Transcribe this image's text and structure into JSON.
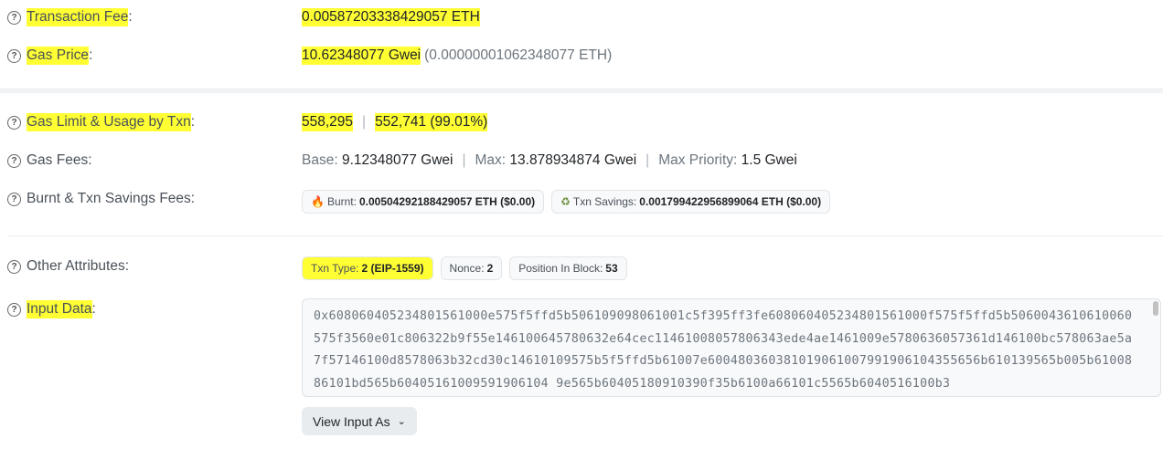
{
  "rows": {
    "transaction_fee": {
      "label": "Transaction Fee",
      "colon": ":",
      "value": "0.00587203338429057 ETH"
    },
    "gas_price": {
      "label": "Gas Price",
      "colon": ":",
      "value": "10.62348077 Gwei",
      "sub": "(0.00000001062348077 ETH)"
    },
    "gas_limit": {
      "label": "Gas Limit & Usage by Txn",
      "colon": ":",
      "limit": "558,295",
      "sep": "|",
      "usage": "552,741 (99.01%)"
    },
    "gas_fees": {
      "label": "Gas Fees:",
      "base_label": "Base:",
      "base": "9.12348077 Gwei",
      "sep": "|",
      "max_label": "Max:",
      "max": "13.878934874 Gwei",
      "prio_label": "Max Priority:",
      "prio": "1.5 Gwei"
    },
    "burnt": {
      "label": "Burnt & Txn Savings Fees:",
      "burnt_label": "Burnt:",
      "burnt_value": "0.00504292188429057 ETH ($0.00)",
      "savings_label": "Txn Savings:",
      "savings_value": "0.001799422956899064 ETH ($0.00)"
    },
    "other": {
      "label": "Other Attributes:",
      "type_label": "Txn Type:",
      "type_value": "2 (EIP-1559)",
      "nonce_label": "Nonce:",
      "nonce_value": "2",
      "pos_label": "Position In Block:",
      "pos_value": "53"
    },
    "input": {
      "label": "Input Data",
      "colon": ":",
      "data": "0x608060405234801561000e575f5ffd5b506109098061001c5f395ff3fe608060405234801561000f575f5ffd5b5060043610610060575f3560e01c806322b9f55e146100645780632e64cec11461008057806343ede4ae1461009e5780636057361d146100bc578063ae5a7f57146100d8578063b32cd30c14610109575b5f5ffd5b61007e600480360381019061007991906104355656b610139565b005b6100886101bd565b60405161009591906104 9e565b60405180910390f35b6100a66101c5565b6040516100b3",
      "button": "View Input As"
    }
  },
  "icons": {
    "help": "?",
    "chevron": "⌄",
    "flame": "🔥",
    "savings": "♻"
  }
}
